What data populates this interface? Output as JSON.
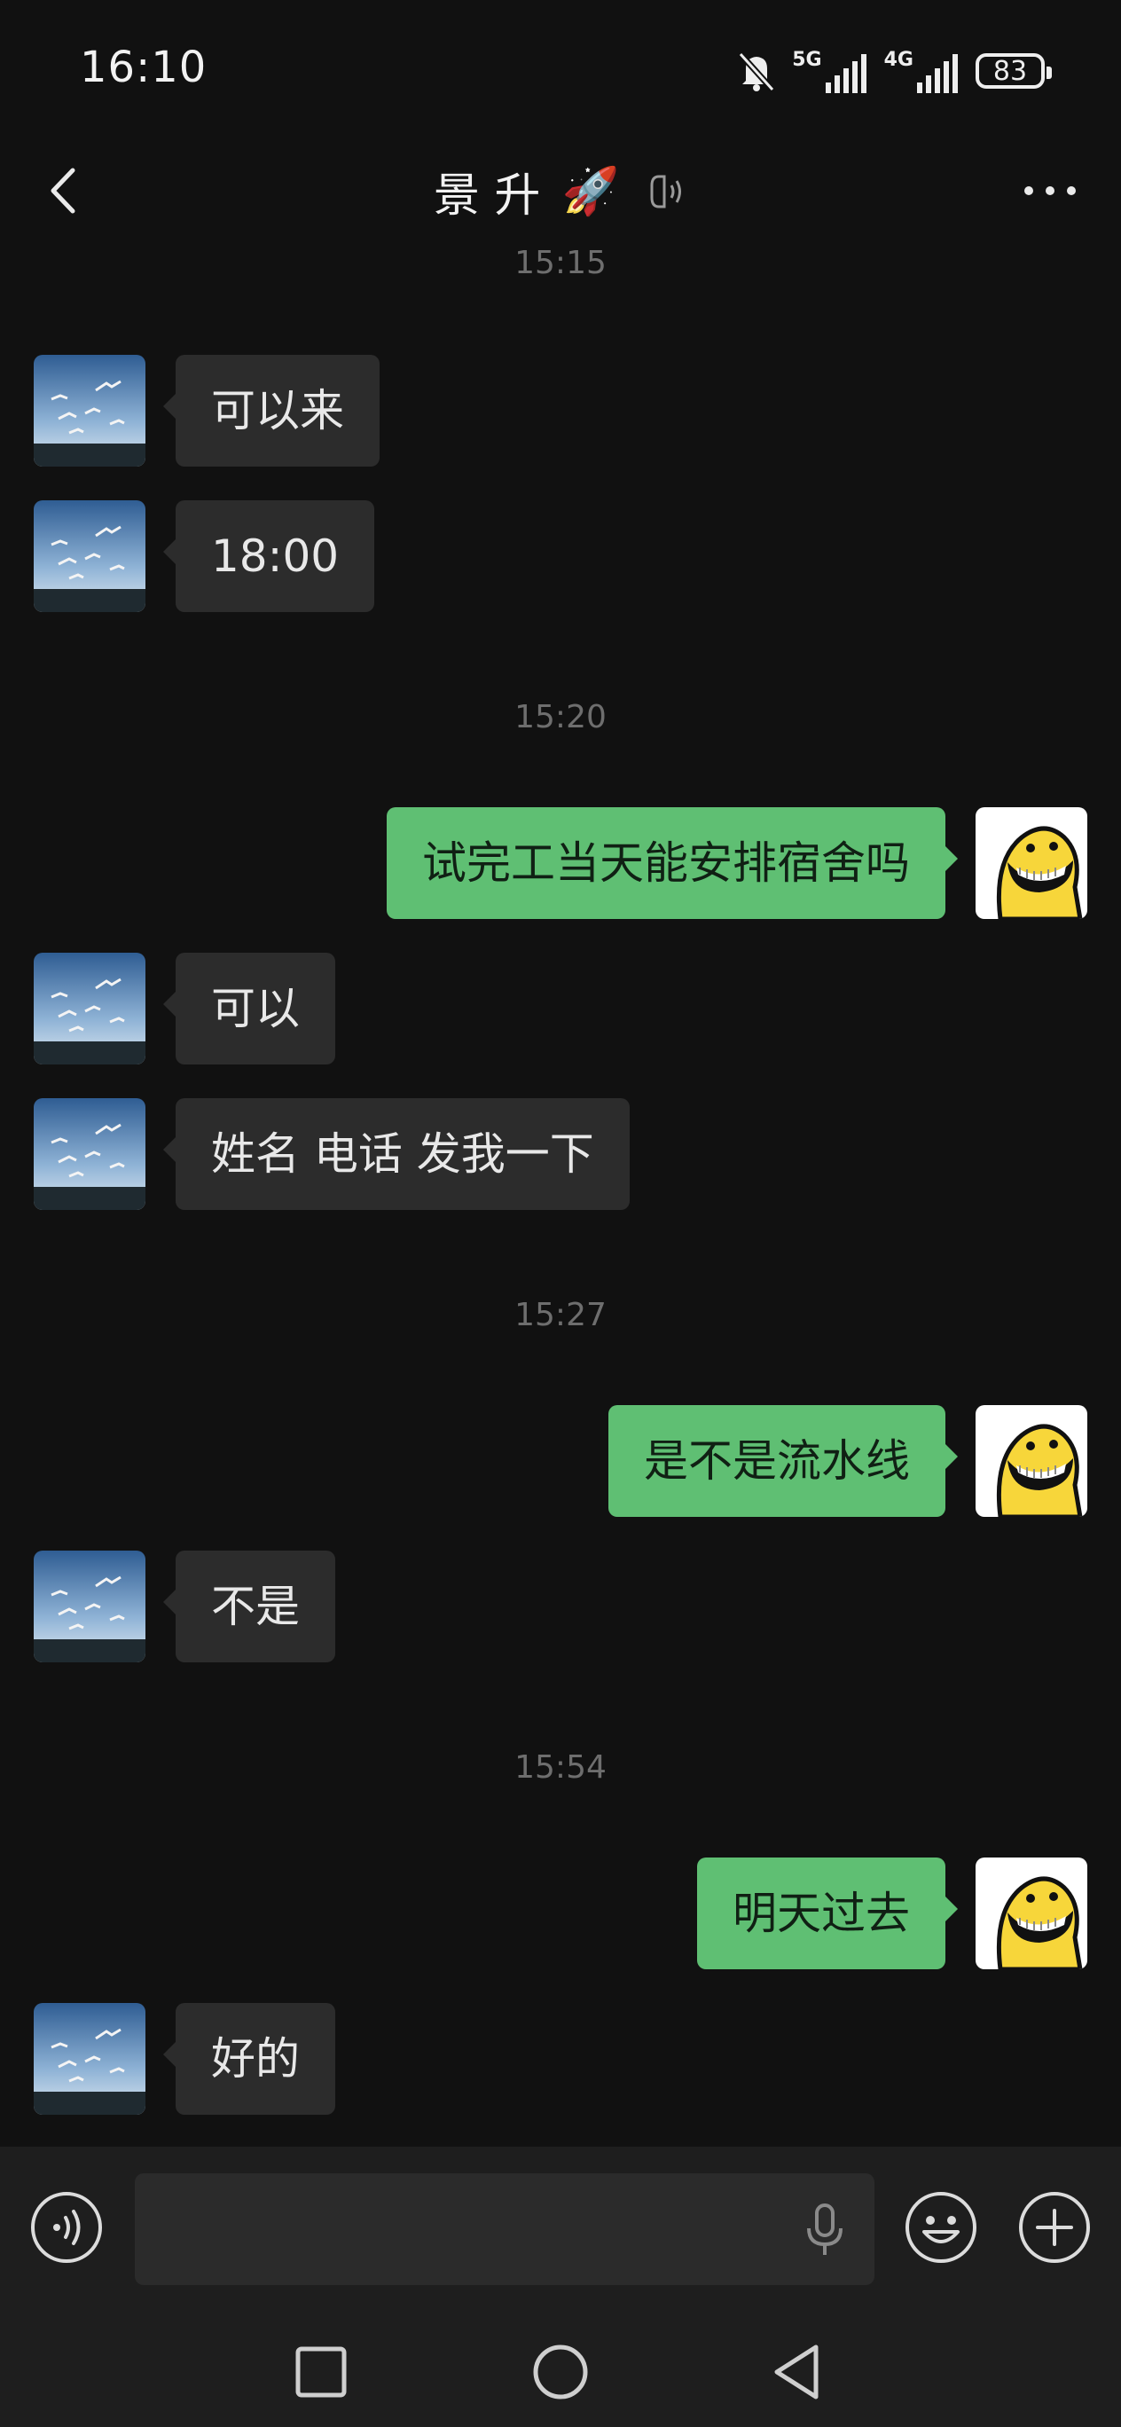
{
  "status_bar": {
    "time": "16:10",
    "net1": "5G",
    "net2": "4G",
    "battery": "83"
  },
  "header": {
    "title": "景 升",
    "title_emoji": "🚀"
  },
  "chat": {
    "top_timestamp": "15:15",
    "messages": [
      {
        "from": "them",
        "text": "可以来"
      },
      {
        "from": "them",
        "text": "18:00"
      },
      {
        "timestamp": "15:20"
      },
      {
        "from": "me",
        "text": "试完工当天能安排宿舍吗"
      },
      {
        "from": "them",
        "text": "可以"
      },
      {
        "from": "them",
        "text": "姓名 电话 发我一下"
      },
      {
        "timestamp": "15:27"
      },
      {
        "from": "me",
        "text": "是不是流水线"
      },
      {
        "from": "them",
        "text": "不是"
      },
      {
        "timestamp": "15:54"
      },
      {
        "from": "me",
        "text": "明天过去"
      },
      {
        "from": "them",
        "text": "好的"
      }
    ]
  },
  "input": {
    "value": "",
    "placeholder": ""
  },
  "colors": {
    "background": "#111111",
    "incoming_bubble": "#2c2c2c",
    "outgoing_bubble": "#5fbf73",
    "timestamp": "#6e6e6e"
  }
}
